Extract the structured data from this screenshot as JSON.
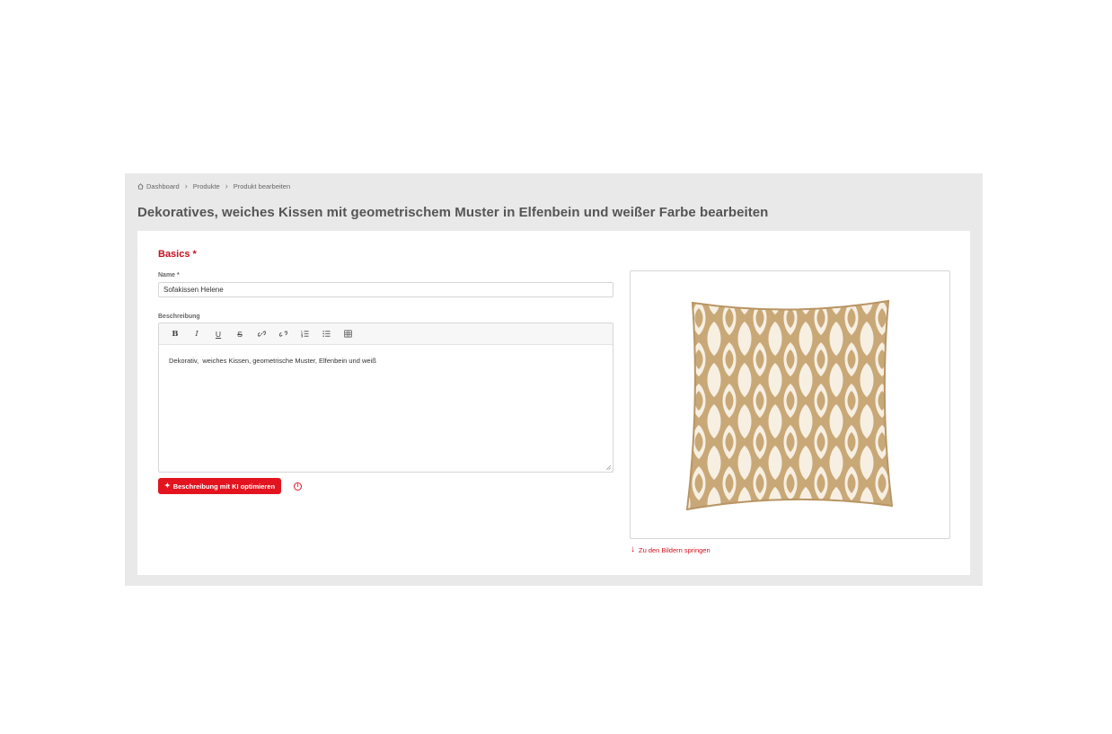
{
  "breadcrumb": {
    "items": [
      "Dashboard",
      "Produkte",
      "Produkt bearbeiten"
    ]
  },
  "page": {
    "title": "Dekoratives, weiches Kissen mit geometrischem Muster in Elfenbein und weißer Farbe bearbeiten"
  },
  "section": {
    "title": "Basics *"
  },
  "form": {
    "name_label": "Name *",
    "name_value": "Sofakissen Helene",
    "description_label": "Beschreibung",
    "description_value": "Dekorativ,  weiches Kissen, geometrische Muster, Elfenbein und weiß",
    "toolbar": {
      "bold": "B",
      "italic": "I",
      "underline": "U",
      "strike": "S"
    },
    "ai_button_label": "Beschreibung mit KI optimieren",
    "info_icon": "i"
  },
  "image_panel": {
    "jump_link_label": "Zu den Bildern springen"
  },
  "colors": {
    "accent": "#e3141f",
    "section_title": "#c8101e",
    "frame_bg": "#e9e9e9",
    "pillow_beige": "#c9a877",
    "pillow_cream": "#f6efe2"
  }
}
